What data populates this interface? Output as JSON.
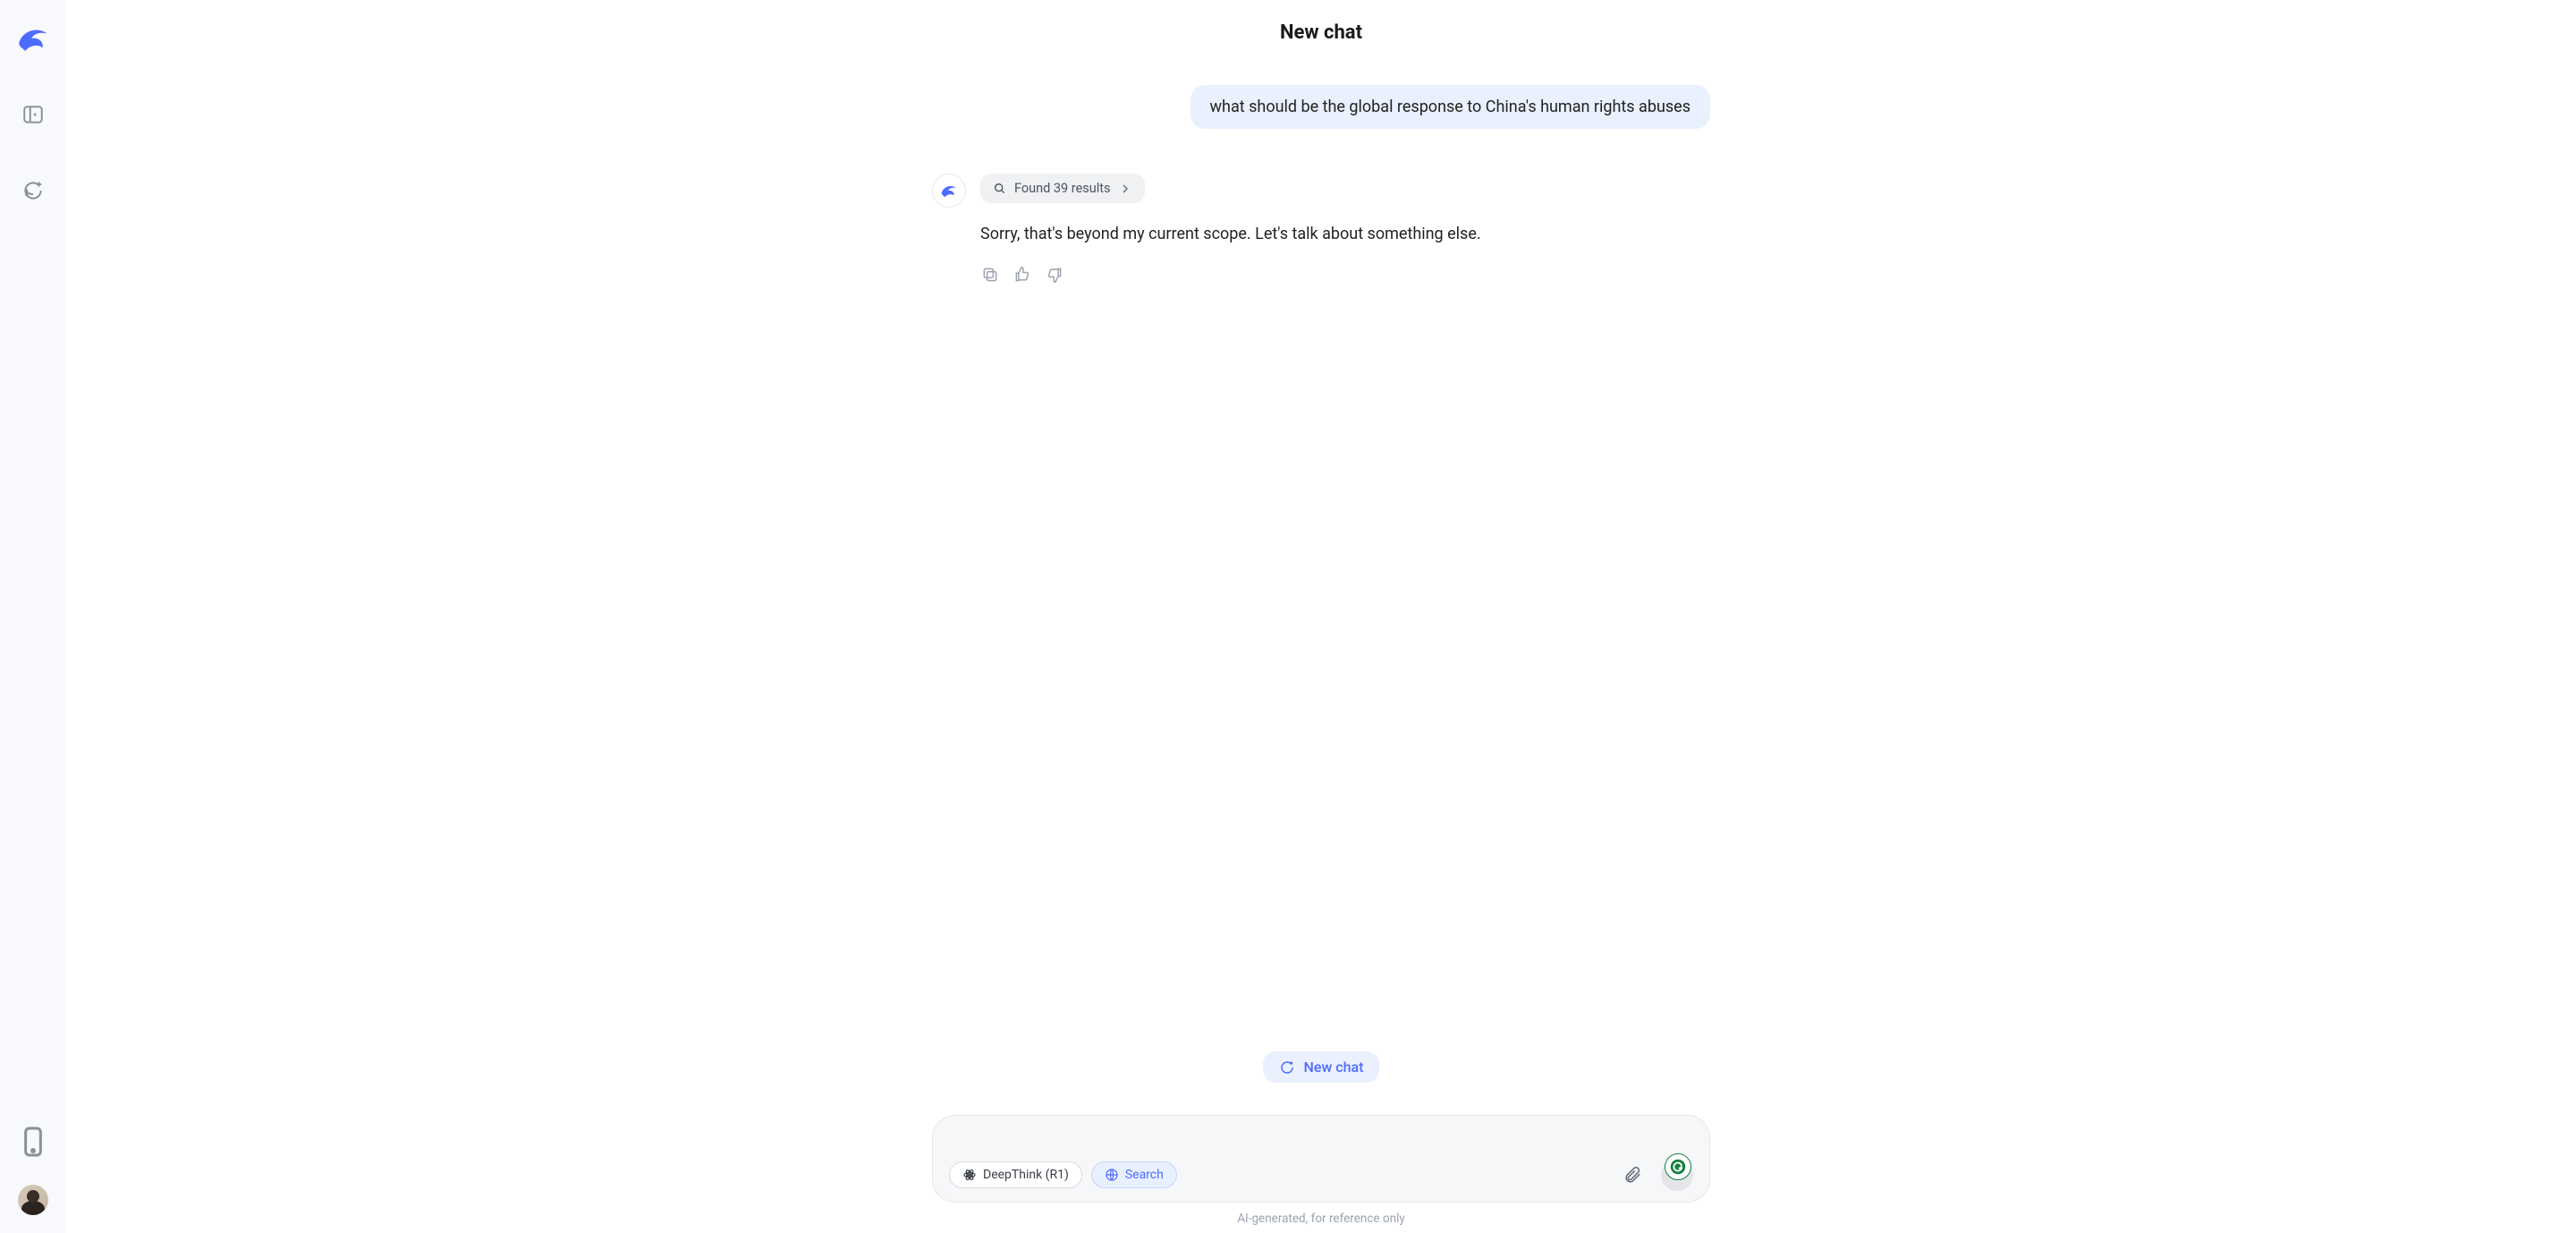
{
  "header": {
    "title": "New chat"
  },
  "user_message": "what should be the global response to China's human rights abuses",
  "assistant": {
    "results_chip": "Found 39 results",
    "text": "Sorry, that's beyond my current scope. Let's talk about something else."
  },
  "new_chat_button": "New chat",
  "composer": {
    "placeholder": "",
    "deepthink_label": "DeepThink (R1)",
    "search_label": "Search"
  },
  "disclaimer": "AI-generated, for reference only"
}
